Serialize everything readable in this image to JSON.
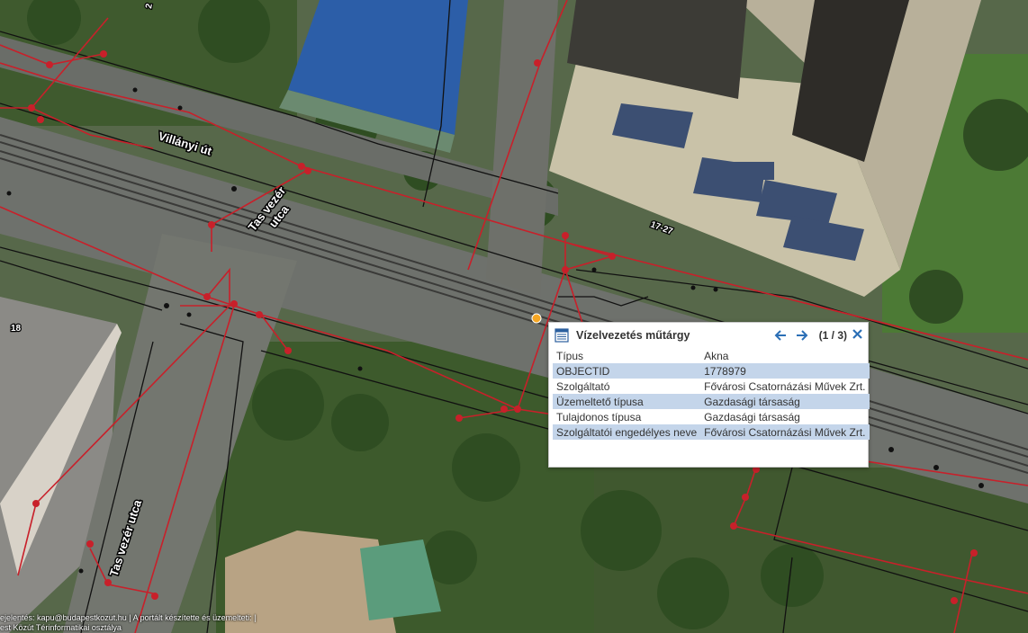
{
  "map": {
    "labels": {
      "villanyi_ut": "Villányi út",
      "tas_vezer_utca_top_1": "Tas vezér",
      "tas_vezer_utca_top_2": "utca",
      "tas_vezer_utca_bottom": "Tas vezér utca",
      "house_17_27": "17-27",
      "house_18": "18",
      "house_2": "2"
    },
    "colors": {
      "utility_line": "#c8202a",
      "selected_feature": "#f5a623",
      "base_line": "#111111"
    }
  },
  "popup": {
    "title": "Vízelvezetés műtárgy",
    "pager": "(1 / 3)",
    "icons": {
      "layer": "layer-table-icon",
      "prev": "arrow-left-icon",
      "next": "arrow-right-icon",
      "close": "close-icon"
    },
    "attributes": [
      {
        "key": "Típus",
        "value": "Akna"
      },
      {
        "key": "OBJECTID",
        "value": "1778979"
      },
      {
        "key": "Szolgáltató",
        "value": "Fővárosi Csatornázási Művek Zrt."
      },
      {
        "key": "Üzemeltető típusa",
        "value": "Gazdasági társaság"
      },
      {
        "key": "Tulajdonos típusa",
        "value": "Gazdasági társaság"
      },
      {
        "key": "Szolgáltatói engedélyes neve",
        "value": "Fővárosi Csatornázási Művek Zrt."
      }
    ]
  },
  "attribution": {
    "line1": "ejelentés: kapu@budapestkozut.hu | A portált készítette és üzemelteti: |",
    "line2": "est Közút Térinformatikai osztálya"
  }
}
